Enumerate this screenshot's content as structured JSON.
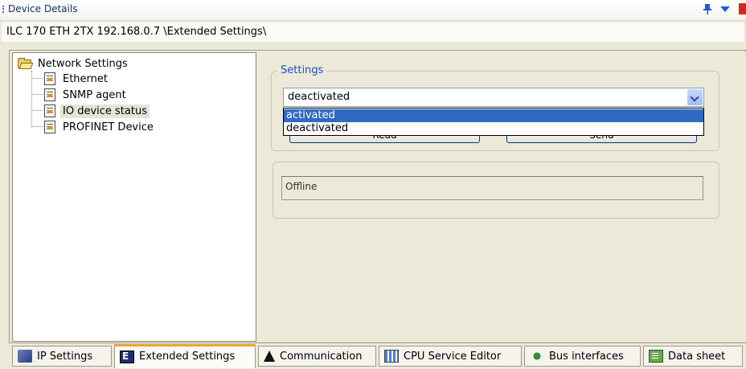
{
  "window": {
    "title": "Device Details",
    "path": "ILC 170 ETH 2TX 192.168.0.7 \\Extended Settings\\"
  },
  "tree": {
    "root": "Network Settings",
    "items": [
      {
        "label": "Ethernet",
        "selected": false
      },
      {
        "label": "SNMP agent",
        "selected": false
      },
      {
        "label": "IO device status",
        "selected": true
      },
      {
        "label": "PROFINET Device",
        "selected": false
      }
    ]
  },
  "settings": {
    "group_label": "Settings",
    "combo_value": "deactivated",
    "options": [
      {
        "label": "activated",
        "highlighted": true
      },
      {
        "label": "deactivated",
        "highlighted": false
      }
    ],
    "button_left": "Read",
    "button_right": "Send"
  },
  "status": {
    "text": "Offline"
  },
  "tabs": [
    {
      "label": "IP Settings",
      "icon": "ip-settings-icon",
      "active": false
    },
    {
      "label": "Extended Settings",
      "icon": "extended-settings-icon",
      "active": true
    },
    {
      "label": "Communication",
      "icon": "communication-icon",
      "active": false
    },
    {
      "label": "CPU Service Editor",
      "icon": "cpu-service-editor-icon",
      "active": false
    },
    {
      "label": "Bus interfaces",
      "icon": "bus-interfaces-icon",
      "active": false
    },
    {
      "label": "Data sheet",
      "icon": "data-sheet-icon",
      "active": false
    }
  ],
  "colors": {
    "selection": "#316ac5",
    "group_label": "#1e50d2",
    "active_tab_accent": "#f0a230"
  }
}
